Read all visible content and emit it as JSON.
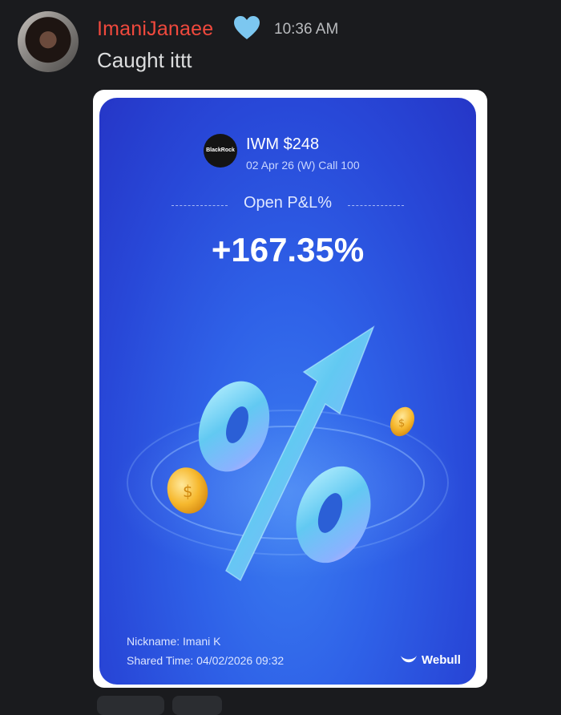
{
  "message": {
    "username": "ImaniJanaee",
    "username_emoji_icon": "blue-heart-icon",
    "timestamp": "10:36 AM",
    "text": "Caught ittt"
  },
  "card": {
    "issuer_logo_text": "BlackRock",
    "ticker_price": "IWM $248",
    "contract": "02 Apr 26 (W) Call 100",
    "pnl_label": "Open P&L%",
    "pnl_value": "+167.35%",
    "nickname": "Nickname: Imani K",
    "shared_time": "Shared Time: 04/02/2026 09:32",
    "brand": "Webull"
  },
  "colors": {
    "background": "#1a1b1e",
    "username": "#f0493d",
    "card_blue": "#2f62e8"
  }
}
